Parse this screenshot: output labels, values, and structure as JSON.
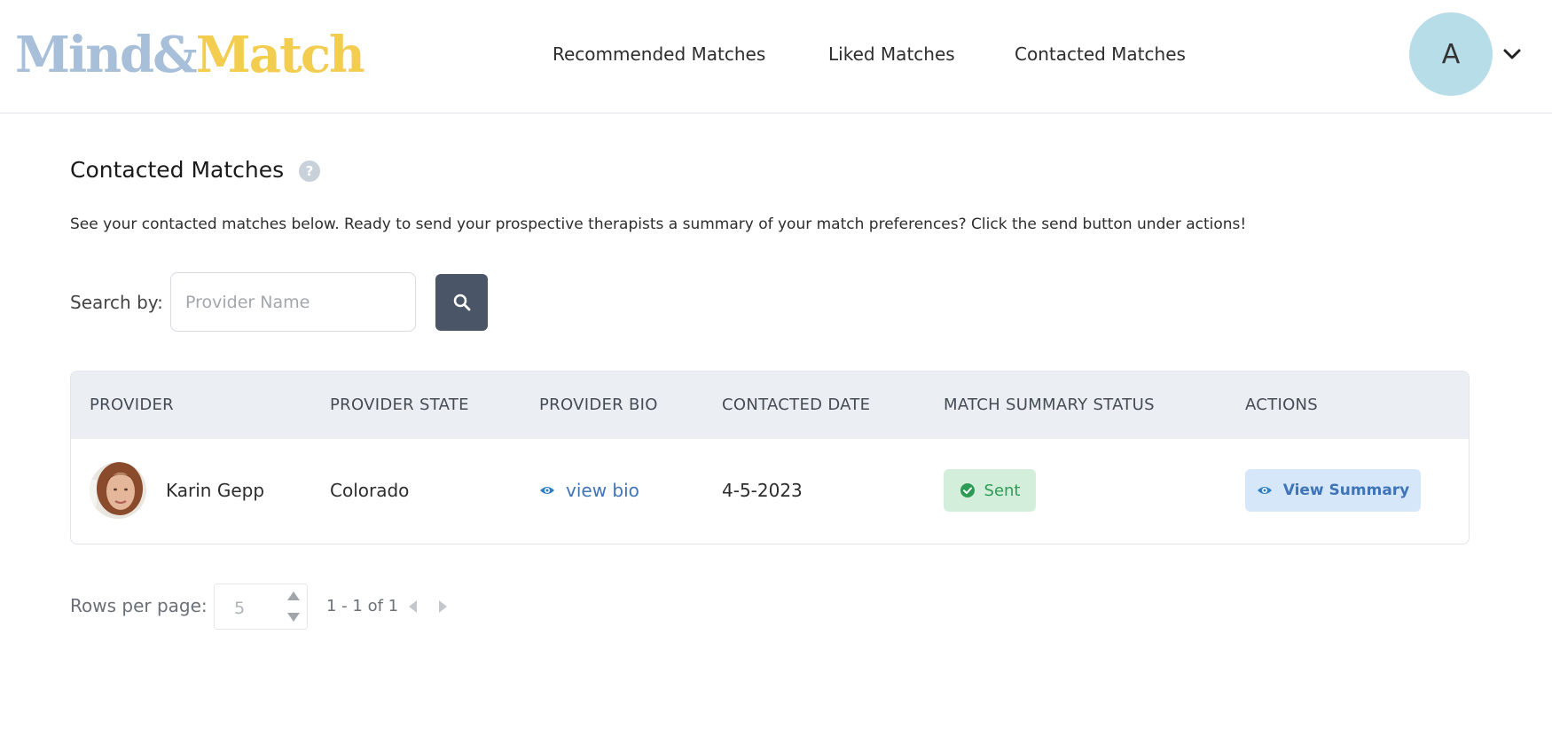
{
  "brand": {
    "mind": "Mind",
    "amp": "&",
    "match": "Match",
    "mind_color": "#a7bfd9",
    "match_color": "#f2cd4f"
  },
  "nav": {
    "items": [
      "Recommended Matches",
      "Liked Matches",
      "Contacted Matches"
    ]
  },
  "user": {
    "avatar_initial": "A"
  },
  "page": {
    "title": "Contacted Matches",
    "help": "?",
    "description": "See your contacted matches below. Ready to send your prospective therapists a summary of your match preferences? Click the send button under actions!"
  },
  "search": {
    "label": "Search by:",
    "placeholder": "Provider Name",
    "value": ""
  },
  "table": {
    "headers": [
      "PROVIDER",
      "PROVIDER STATE",
      "PROVIDER BIO",
      "CONTACTED DATE",
      "MATCH SUMMARY STATUS",
      "ACTIONS"
    ],
    "rows": [
      {
        "provider": "Karin Gepp",
        "state": "Colorado",
        "bio_link": "view bio",
        "contacted_date": "4-5-2023",
        "status": "Sent",
        "action": "View Summary"
      }
    ]
  },
  "pagination": {
    "rows_label": "Rows per page:",
    "rows_per_page": "5",
    "range": "1 - 1 of 1"
  },
  "colors": {
    "accent_blue": "#3f74b8",
    "status_green": "#2f9a55",
    "search_button": "#4b5568",
    "avatar": "#b7dde9"
  },
  "icons": [
    "search-icon",
    "help-icon",
    "chevron-down-icon",
    "eye-icon",
    "check-circle-icon"
  ]
}
